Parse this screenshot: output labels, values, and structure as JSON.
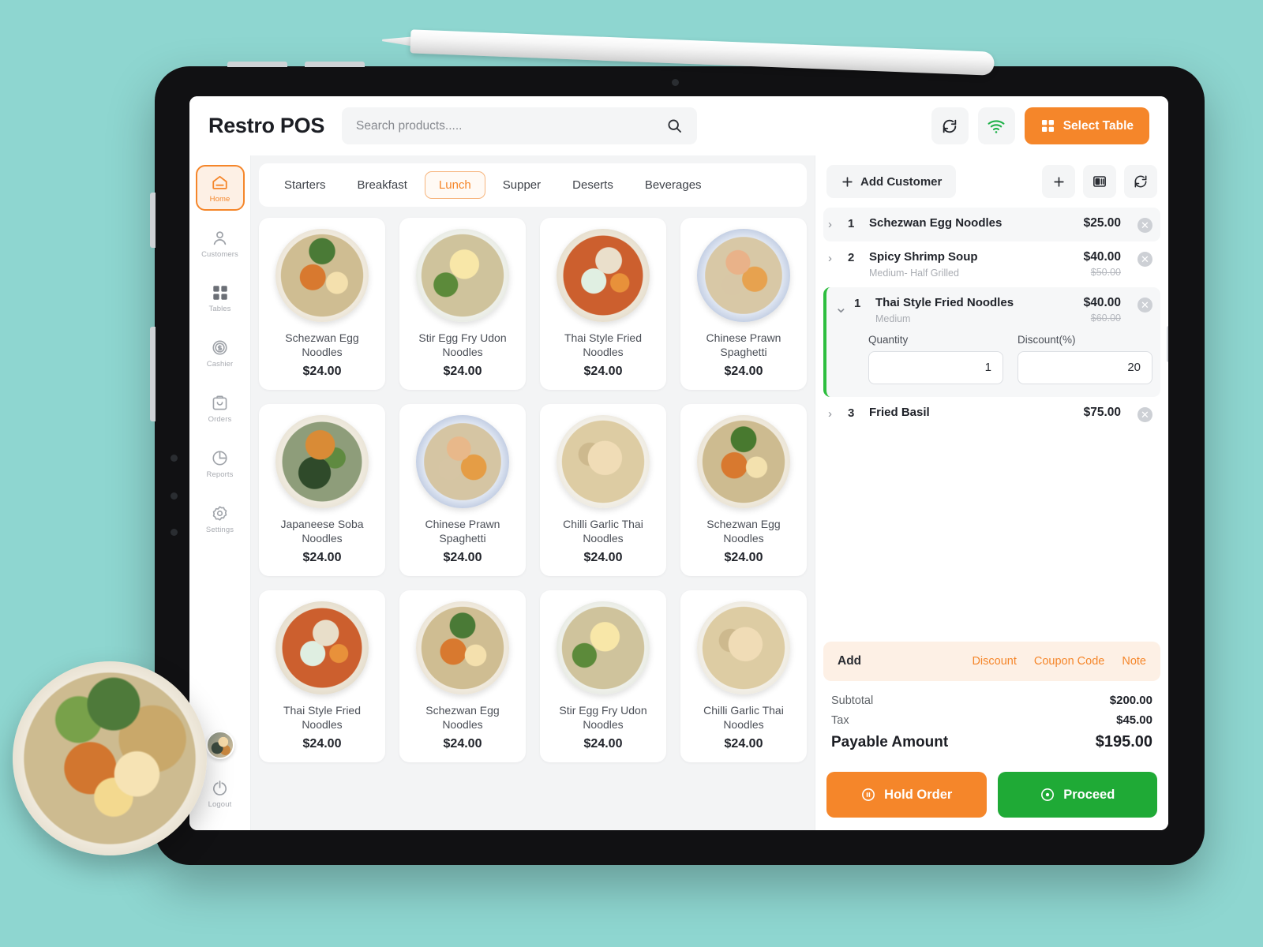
{
  "app": {
    "brand": "Restro POS"
  },
  "search": {
    "placeholder": "Search products.....",
    "value": "",
    "icon": "search-icon"
  },
  "header": {
    "refresh_icon": "refresh-icon",
    "wifi_icon": "wifi-icon",
    "select_table_label": "Select Table",
    "select_table_icon": "grid-icon"
  },
  "sidebar": {
    "items": [
      {
        "label": "Home",
        "icon": "home-icon",
        "active": true
      },
      {
        "label": "Customers",
        "icon": "user-icon",
        "active": false
      },
      {
        "label": "Tables",
        "icon": "grid-icon",
        "active": false
      },
      {
        "label": "Cashier",
        "icon": "dollar-circle-icon",
        "active": false
      },
      {
        "label": "Orders",
        "icon": "bag-icon",
        "active": false
      },
      {
        "label": "Reports",
        "icon": "pie-chart-icon",
        "active": false
      },
      {
        "label": "Settings",
        "icon": "gear-icon",
        "active": false
      }
    ],
    "logout": {
      "label": "Logout",
      "icon": "logout-icon"
    },
    "avatar": "user-avatar"
  },
  "categories": {
    "tabs": [
      {
        "label": "Starters",
        "active": false
      },
      {
        "label": "Breakfast",
        "active": false
      },
      {
        "label": "Lunch",
        "active": true
      },
      {
        "label": "Supper",
        "active": false
      },
      {
        "label": "Deserts",
        "active": false
      },
      {
        "label": "Beverages",
        "active": false
      }
    ]
  },
  "products": [
    {
      "name": "Schezwan Egg Noodles",
      "price": "$24.00"
    },
    {
      "name": "Stir Egg Fry Udon Noodles",
      "price": "$24.00"
    },
    {
      "name": "Thai Style Fried Noodles",
      "price": "$24.00"
    },
    {
      "name": "Chinese Prawn Spaghetti",
      "price": "$24.00"
    },
    {
      "name": "Japaneese Soba Noodles",
      "price": "$24.00"
    },
    {
      "name": "Chinese Prawn Spaghetti",
      "price": "$24.00"
    },
    {
      "name": "Chilli Garlic Thai Noodles",
      "price": "$24.00"
    },
    {
      "name": "Schezwan Egg Noodles",
      "price": "$24.00"
    },
    {
      "name": "Thai Style Fried Noodles",
      "price": "$24.00"
    },
    {
      "name": "Schezwan Egg Noodles",
      "price": "$24.00"
    },
    {
      "name": "Stir Egg Fry Udon Noodles",
      "price": "$24.00"
    },
    {
      "name": "Chilli Garlic Thai Noodles",
      "price": "$24.00"
    }
  ],
  "order": {
    "add_customer_label": "Add Customer",
    "add_customer_icon": "plus-icon",
    "plus_icon": "plus-icon",
    "card_icon": "card-reader-icon",
    "refresh_icon": "refresh-icon",
    "items": [
      {
        "qty": "1",
        "name": "Schezwan Egg Noodles",
        "variant": "",
        "price": "$25.00",
        "old_price": "",
        "expanded": false,
        "highlight": true
      },
      {
        "qty": "2",
        "name": "Spicy Shrimp Soup",
        "variant": "Medium- Half Grilled",
        "price": "$40.00",
        "old_price": "$50.00",
        "expanded": false,
        "highlight": false
      },
      {
        "qty": "1",
        "name": "Thai Style Fried Noodles",
        "variant": "Medium",
        "price": "$40.00",
        "old_price": "$60.00",
        "expanded": true,
        "highlight": false,
        "quantity_label": "Quantity",
        "quantity_value": "1",
        "discount_label": "Discount(%)",
        "discount_value": "20"
      },
      {
        "qty": "3",
        "name": "Fried Basil",
        "variant": "",
        "price": "$75.00",
        "old_price": "",
        "expanded": false,
        "highlight": false
      }
    ],
    "add_bar": {
      "add_label": "Add",
      "discount_label": "Discount",
      "coupon_label": "Coupon Code",
      "note_label": "Note"
    },
    "totals": [
      {
        "label": "Subtotal",
        "value": "$200.00"
      },
      {
        "label": "Tax",
        "value": "$45.00"
      }
    ],
    "payable_label": "Payable Amount",
    "payable_value": "$195.00",
    "hold_label": "Hold Order",
    "hold_icon": "pause-circle-icon",
    "proceed_label": "Proceed",
    "proceed_icon": "play-circle-icon"
  },
  "colors": {
    "background": "#8ed6d0",
    "accent_orange": "#f5862a",
    "accent_green": "#1faa36",
    "panel": "#ffffff",
    "surface": "#f3f4f5"
  }
}
